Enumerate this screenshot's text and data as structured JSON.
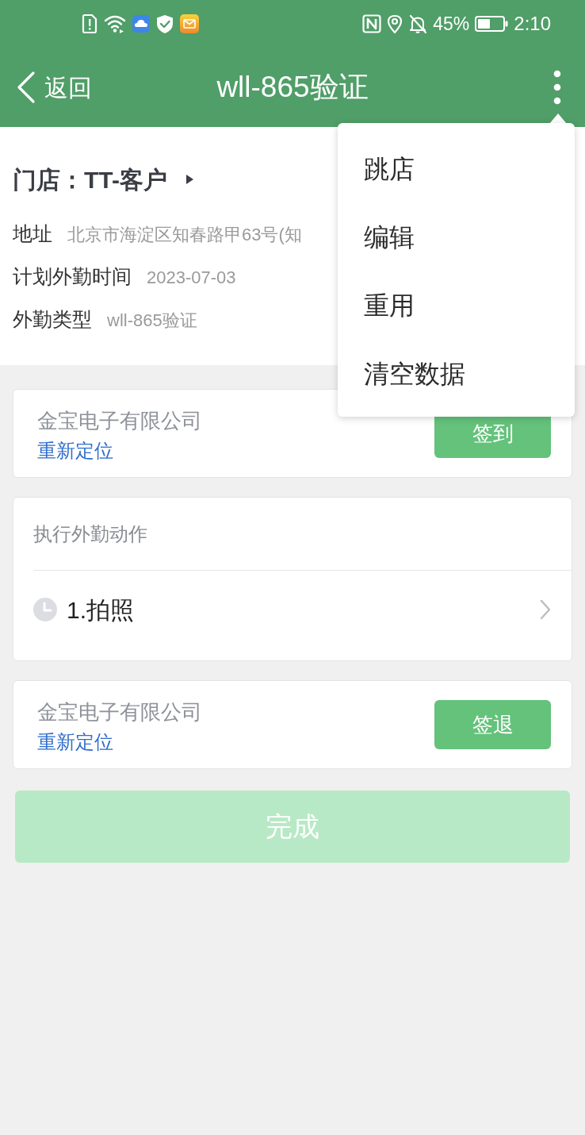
{
  "status_bar": {
    "battery": "45%",
    "time": "2:10"
  },
  "header": {
    "back": "返回",
    "title": "wll-865验证"
  },
  "menu": {
    "items": [
      {
        "label": "跳店"
      },
      {
        "label": "编辑"
      },
      {
        "label": "重用"
      },
      {
        "label": "清空数据"
      }
    ]
  },
  "store": {
    "title": "门店：TT-客户",
    "fields": [
      {
        "label": "地址",
        "value": "北京市海淀区知春路甲63号(知"
      },
      {
        "label": "计划外勤时间",
        "value": "2023-07-03"
      },
      {
        "label": "外勤类型",
        "value": "wll-865验证"
      }
    ]
  },
  "sign_in": {
    "company": "金宝电子有限公司",
    "relocate": "重新定位",
    "button": "签到"
  },
  "actions": {
    "title": "执行外勤动作",
    "items": [
      {
        "label": "1.拍照"
      }
    ]
  },
  "sign_out": {
    "company": "金宝电子有限公司",
    "relocate": "重新定位",
    "button": "签退"
  },
  "done_button": {
    "label": "完成",
    "disabled": true
  }
}
